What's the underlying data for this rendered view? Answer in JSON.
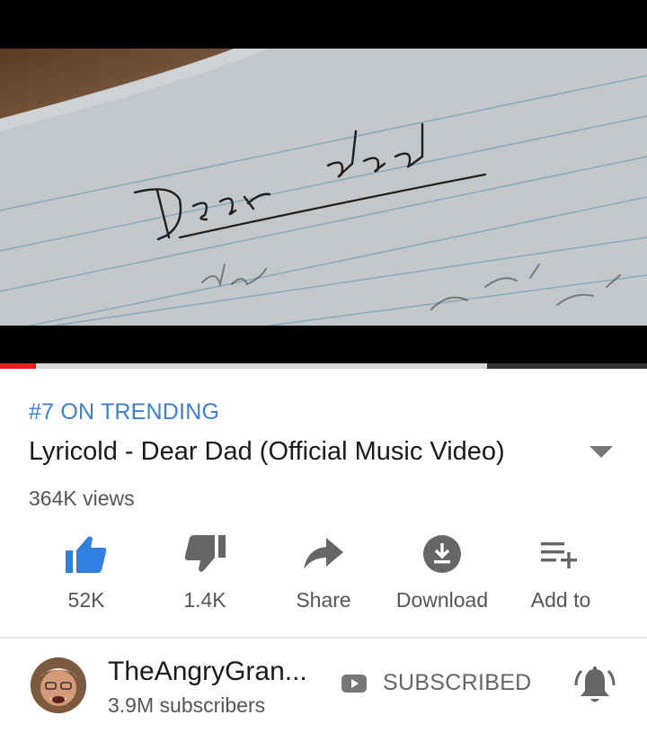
{
  "player": {
    "progress_played": 0.055,
    "progress_buffer_start": 0.753,
    "progress_buffer_end": 1.0,
    "colors": {
      "played": "#e62117",
      "buffered": "#333333",
      "track": "#d7d7d7"
    }
  },
  "video": {
    "trending_badge": "#7 ON TRENDING",
    "title": "Lyricold - Dear Dad (Official Music Video)",
    "views": "364K views"
  },
  "actions": [
    {
      "icon": "thumbs-up-icon",
      "label": "52K",
      "active": true
    },
    {
      "icon": "thumbs-down-icon",
      "label": "1.4K",
      "active": false
    },
    {
      "icon": "share-icon",
      "label": "Share",
      "active": false
    },
    {
      "icon": "download-icon",
      "label": "Download",
      "active": false
    },
    {
      "icon": "playlist-add-icon",
      "label": "Add to",
      "active": false
    }
  ],
  "channel": {
    "name": "TheAngryGran...",
    "subscribers": "3.9M subscribers",
    "subscribe_label": "SUBSCRIBED",
    "bell_icon": "notification-bell-icon"
  },
  "colors": {
    "accent": "#3d7fd6",
    "text": "#1a1a1a",
    "secondary": "#555555"
  }
}
